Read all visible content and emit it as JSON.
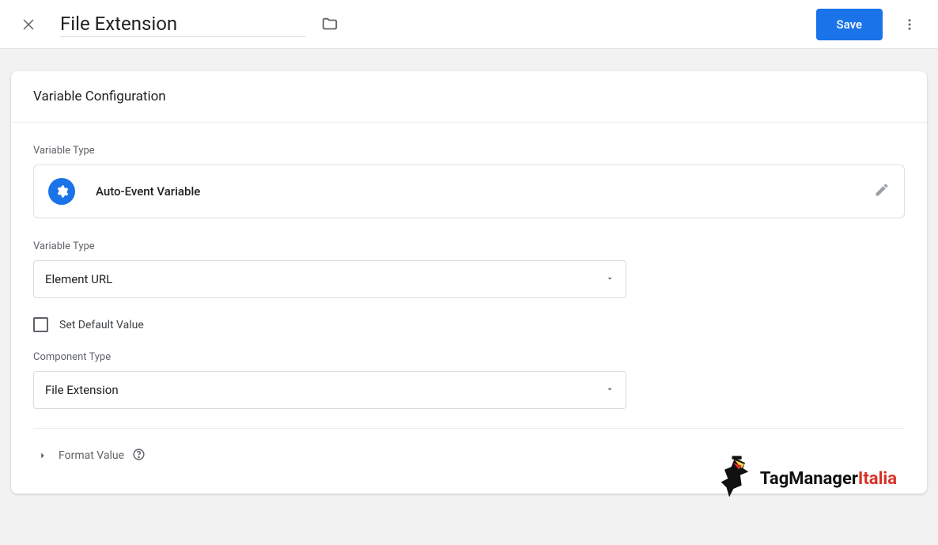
{
  "header": {
    "title": "File Extension",
    "save_label": "Save"
  },
  "panel": {
    "heading": "Variable Configuration",
    "type_label": "Variable Type",
    "selected_type": "Auto-Event Variable",
    "variable_type_label": "Variable Type",
    "variable_type_value": "Element URL",
    "checkbox_label": "Set Default Value",
    "component_type_label": "Component Type",
    "component_type_value": "File Extension",
    "format_value_label": "Format Value"
  },
  "watermark": {
    "brand_1": "TagManager",
    "brand_2": "Italia"
  }
}
